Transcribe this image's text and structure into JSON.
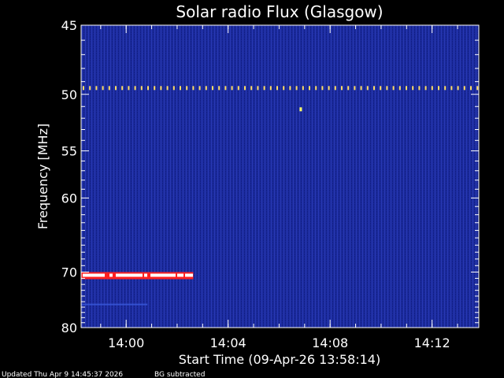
{
  "chart_data": {
    "type": "heatmap",
    "title": "Solar radio Flux (Glasgow)",
    "xlabel": "Start Time (09-Apr-26 13:58:14)",
    "ylabel": "Frequency [MHz]",
    "x_range_minutes": [
      0,
      15.6
    ],
    "x_ticks": [
      {
        "label": "14:00",
        "minute": 1.767
      },
      {
        "label": "14:04",
        "minute": 5.767
      },
      {
        "label": "14:08",
        "minute": 9.767
      },
      {
        "label": "14:12",
        "minute": 13.767
      }
    ],
    "y_scale": "reciprocal",
    "ylim": [
      45,
      80
    ],
    "y_ticks": [
      45,
      50,
      55,
      60,
      70,
      80
    ],
    "background_color": "#1a2a9a",
    "features": [
      {
        "type": "periodic-dots",
        "freq_mhz": 49.5,
        "start_min": 0,
        "end_min": 15.6,
        "color": "#ffdd66"
      },
      {
        "type": "point",
        "freq_mhz": 51.2,
        "minute": 8.6,
        "color": "#ffff66"
      },
      {
        "type": "band",
        "freq_mhz": 70.5,
        "start_min": 0,
        "end_min": 4.4,
        "color": "#ff2020"
      },
      {
        "type": "band",
        "freq_mhz": 75.5,
        "start_min": 0,
        "end_min": 2.6,
        "color": "#3a5adc"
      }
    ]
  },
  "footer": {
    "updated": "Updated Thu Apr  9 14:45:37 2026",
    "note": "BG subtracted"
  }
}
